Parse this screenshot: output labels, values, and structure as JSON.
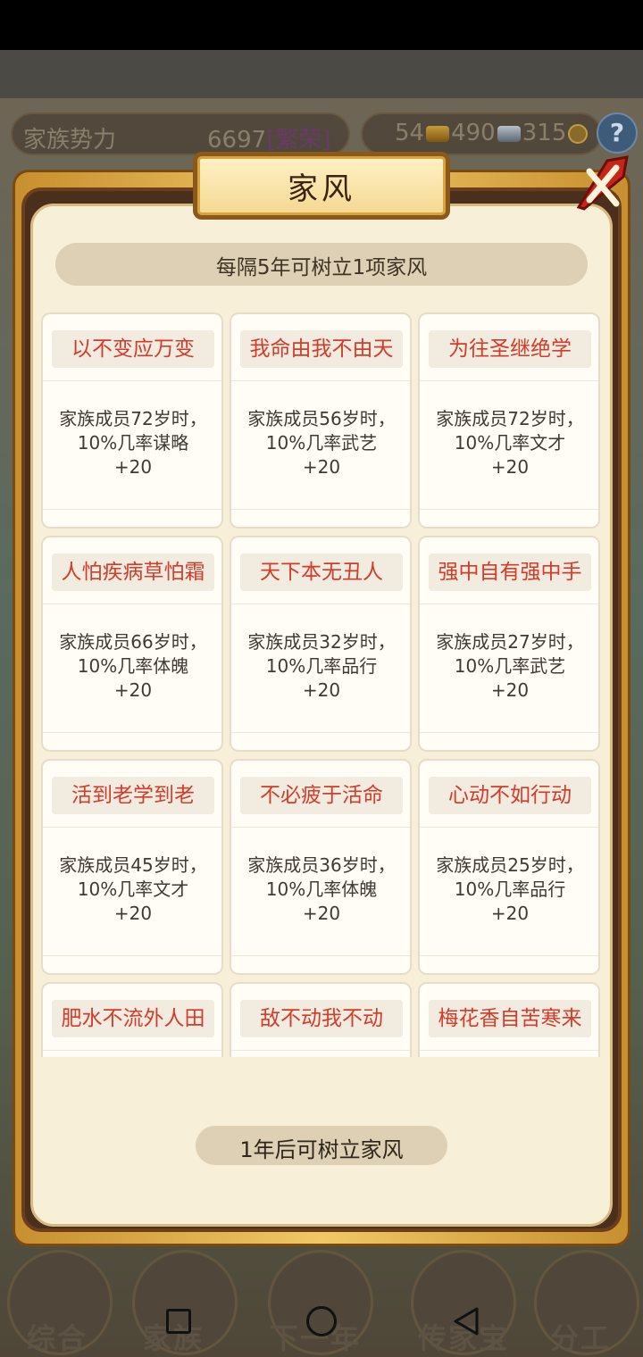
{
  "status_bar": {},
  "top_bar": {
    "power_label": "家族势力",
    "power_value": "6697",
    "power_rank": "[繁荣]",
    "gold": "54",
    "silver": "490",
    "coins": "315",
    "help": "?"
  },
  "modal": {
    "title": "家风",
    "subtitle": "每隔5年可树立1项家风",
    "footer": "1年后可树立家风",
    "cards": [
      {
        "title": "以不变应万变",
        "desc": "家族成员72岁时，10%几率谋略+20"
      },
      {
        "title": "我命由我不由天",
        "desc": "家族成员56岁时，10%几率武艺+20"
      },
      {
        "title": "为往圣继绝学",
        "desc": "家族成员72岁时，10%几率文才+20"
      },
      {
        "title": "人怕疾病草怕霜",
        "desc": "家族成员66岁时，10%几率体魄+20"
      },
      {
        "title": "天下本无丑人",
        "desc": "家族成员32岁时，10%几率品行+20"
      },
      {
        "title": "强中自有强中手",
        "desc": "家族成员27岁时，10%几率武艺+20"
      },
      {
        "title": "活到老学到老",
        "desc": "家族成员45岁时，10%几率文才+20"
      },
      {
        "title": "不必疲于活命",
        "desc": "家族成员36岁时，10%几率体魄+20"
      },
      {
        "title": "心动不如行动",
        "desc": "家族成员25岁时，10%几率品行+20"
      },
      {
        "title": "肥水不流外人田",
        "desc": ""
      },
      {
        "title": "敌不动我不动",
        "desc": ""
      },
      {
        "title": "梅花香自苦寒来",
        "desc": ""
      }
    ]
  },
  "bottom_nav": {
    "items": [
      "综合",
      "家族",
      "下一年",
      "传家宝",
      "分工"
    ]
  },
  "colors": {
    "card_title": "#d23c2a",
    "frame_gold": "#f0c866",
    "panel_bg": "#f8efd9"
  }
}
